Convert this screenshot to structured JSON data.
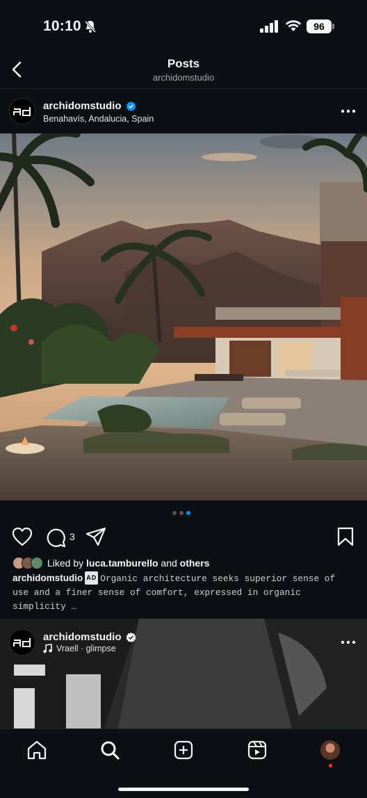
{
  "status_bar": {
    "time": "10:10",
    "battery": "96"
  },
  "header": {
    "title": "Posts",
    "subtitle": "archidomstudio"
  },
  "post1": {
    "username": "archidomstudio",
    "location": "Benahavís, Andalucia, Spain",
    "avatar_text": "Ad",
    "comment_count": "3",
    "carousel": {
      "total": 3,
      "active_index": 2
    },
    "liked_by_prefix": "Liked by",
    "liked_by_user": "luca.tamburello",
    "liked_by_and": "and",
    "liked_by_others": "others",
    "caption_user": "archidomstudio",
    "caption_badge": "AD",
    "caption_text": "Organic architecture seeks superior sense of use and a finer sense of comfort, expressed in organic simplicity …"
  },
  "post2": {
    "username": "archidomstudio",
    "audio": "Vraell · glimpse",
    "avatar_text": "Ad"
  },
  "tabs": [
    {
      "name": "home",
      "icon": "home-icon"
    },
    {
      "name": "search",
      "icon": "search-icon"
    },
    {
      "name": "create",
      "icon": "plus-square-icon"
    },
    {
      "name": "reels",
      "icon": "reels-icon"
    },
    {
      "name": "profile",
      "icon": "avatar"
    }
  ],
  "colors": {
    "background": "#0c1014",
    "accent": "#0095f6",
    "verified": "#0095f6",
    "notification": "#ff3040"
  }
}
